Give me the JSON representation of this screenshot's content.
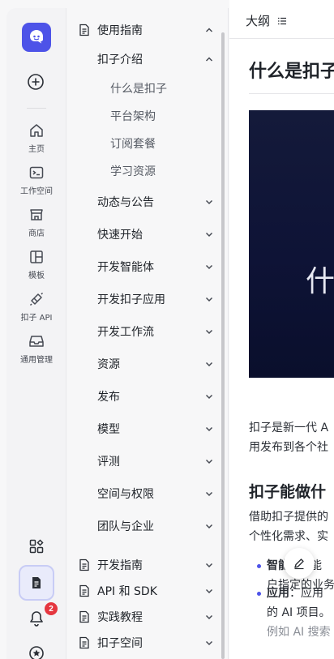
{
  "rail": {
    "items": [
      {
        "label": "主页",
        "icon": "home-icon"
      },
      {
        "label": "工作空间",
        "icon": "terminal-icon"
      },
      {
        "label": "商店",
        "icon": "store-icon"
      },
      {
        "label": "模板",
        "icon": "template-icon"
      },
      {
        "label": "扣子 API",
        "icon": "api-icon"
      },
      {
        "label": "通用管理",
        "icon": "inbox-icon"
      }
    ],
    "notification_count": "2"
  },
  "nav": {
    "section_usage": "使用指南",
    "group_intro": "扣子介绍",
    "intro_items": [
      "什么是扣子",
      "平台架构",
      "订阅套餐",
      "学习资源"
    ],
    "groups": [
      "动态与公告",
      "快速开始",
      "开发智能体",
      "开发扣子应用",
      "开发工作流",
      "资源",
      "发布",
      "模型",
      "评测",
      "空间与权限",
      "团队与企业"
    ],
    "sections": [
      "开发指南",
      "API 和 SDK",
      "实践教程",
      "扣子空间"
    ]
  },
  "content": {
    "outline_label": "大纲",
    "page_title": "什么是扣子",
    "hero_text": "什",
    "para1_line1": "扣子是新一代 A",
    "para1_line2": "用发布到各个社",
    "h2": "扣子能做什",
    "para2_line1": "借助扣子提供的",
    "para2_line2": "个性化需求、实",
    "bullet1_bold": "智能",
    "bullet1_rest": "智能",
    "bullet1_line2": "户指定的业务",
    "bullet2_bold": "应用",
    "bullet2_rest": "：应用",
    "bullet2_line2": "的 AI 项目。",
    "bullet2_line3": "例如 AI 搜索"
  },
  "colors": {
    "accent": "#4d53e8",
    "badge": "#e5363f"
  }
}
